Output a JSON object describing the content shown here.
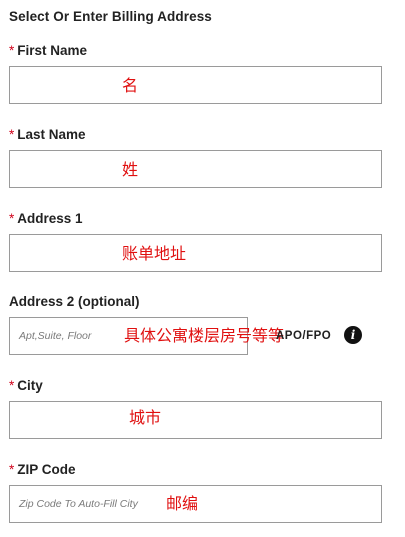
{
  "form": {
    "title": "Select Or Enter Billing Address",
    "required_marker": "*",
    "first_name": {
      "label": "First Name",
      "value": "",
      "annotation": "名"
    },
    "last_name": {
      "label": "Last Name",
      "value": "",
      "annotation": "姓"
    },
    "address1": {
      "label": "Address 1",
      "value": "",
      "annotation": "账单地址"
    },
    "address2": {
      "label": "Address 2 (optional)",
      "placeholder": "Apt,Suite, Floor",
      "annotation": "具体公寓楼层房号等等",
      "apo_fpo_label": "APO/FPO",
      "info_icon": "i"
    },
    "city": {
      "label": "City",
      "value": "",
      "annotation": "城市"
    },
    "zip": {
      "label": "ZIP Code",
      "placeholder": "Zip Code To Auto-Fill City",
      "annotation": "邮编"
    }
  },
  "colors": {
    "required": "#d0021b",
    "annotation": "#e01010",
    "border": "#9a9a9a"
  }
}
